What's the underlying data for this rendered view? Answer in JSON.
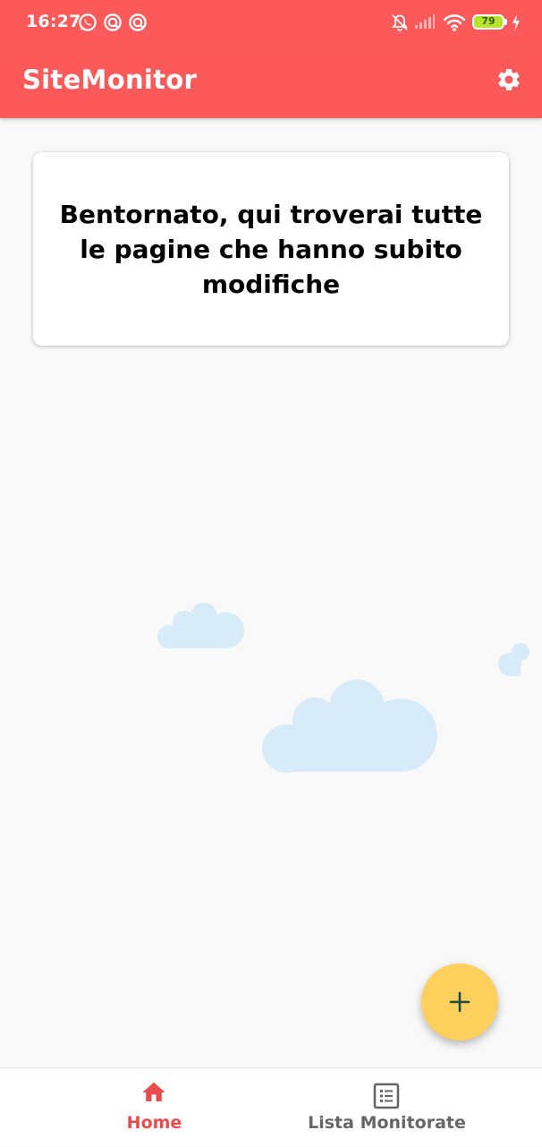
{
  "status_bar": {
    "time": "16:27",
    "notification_icons": [
      "whatsapp-icon",
      "app-notification-icon",
      "app-notification-icon"
    ],
    "right_icons": [
      "alarm-off-icon",
      "signal-icon",
      "wifi-icon",
      "battery-icon",
      "charging-icon"
    ],
    "battery_level": "79",
    "battery_color": "#b7e32d"
  },
  "app_bar": {
    "title": "SiteMonitor",
    "settings_icon": "gear-icon",
    "background": "#fc5a5a"
  },
  "welcome_card": {
    "message": "Bentornato, qui troverai tutte le pagine che hanno subito modifiche"
  },
  "fab": {
    "icon": "plus-icon",
    "color": "#fdd05d"
  },
  "bottom_nav": {
    "items": [
      {
        "label": "Home",
        "icon": "home-icon",
        "active": true,
        "color": "#e84c4c"
      },
      {
        "label": "Lista Monitorate",
        "icon": "list-icon",
        "active": false,
        "color": "#666666"
      }
    ]
  }
}
